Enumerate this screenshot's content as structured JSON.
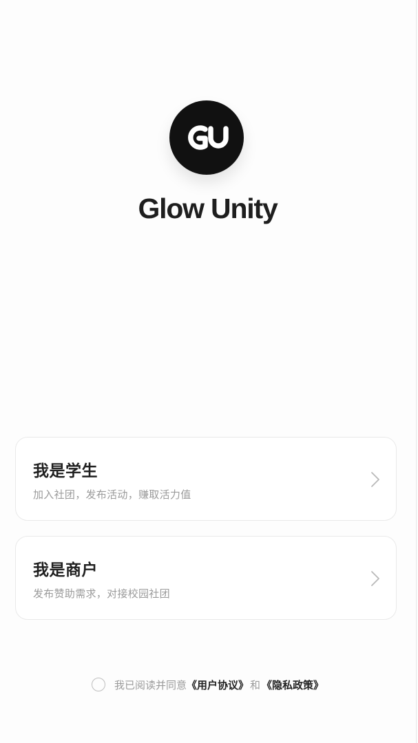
{
  "app": {
    "name": "Glow Unity",
    "logo_icon": "glow-unity-logo-icon"
  },
  "roles": [
    {
      "title": "我是学生",
      "description": "加入社团，发布活动，赚取活力值",
      "icon": "chevron-right-icon"
    },
    {
      "title": "我是商户",
      "description": "发布赞助需求，对接校园社团",
      "icon": "chevron-right-icon"
    }
  ],
  "agreement": {
    "prefix": "我已阅读并同意",
    "user_agreement": "《用户协议》",
    "conjunction": "和",
    "privacy_policy": "《隐私政策》",
    "checked": false
  },
  "colors": {
    "background": "#fdfdfd",
    "logo": "#111111",
    "card_border": "#e9e9e9",
    "muted_text": "#9a9a9a",
    "primary_text": "#1f1f1f"
  }
}
